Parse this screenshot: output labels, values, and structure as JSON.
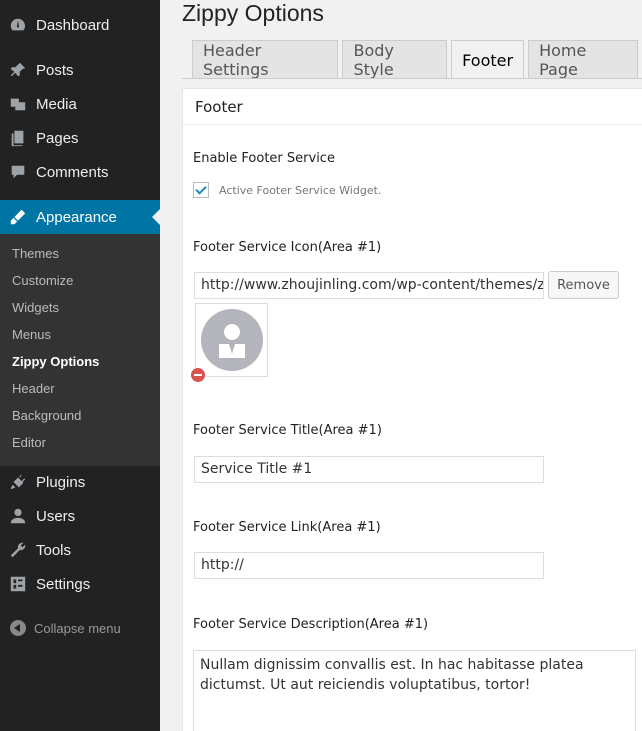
{
  "sidebar": {
    "items": [
      {
        "label": "Dashboard",
        "icon": "dashboard-icon"
      },
      {
        "label": "Posts",
        "icon": "pin-icon"
      },
      {
        "label": "Media",
        "icon": "media-icon"
      },
      {
        "label": "Pages",
        "icon": "pages-icon"
      },
      {
        "label": "Comments",
        "icon": "comment-icon"
      },
      {
        "label": "Appearance",
        "icon": "brush-icon"
      },
      {
        "label": "Plugins",
        "icon": "plug-icon"
      },
      {
        "label": "Users",
        "icon": "user-icon"
      },
      {
        "label": "Tools",
        "icon": "wrench-icon"
      },
      {
        "label": "Settings",
        "icon": "settings-icon"
      }
    ],
    "submenu": [
      "Themes",
      "Customize",
      "Widgets",
      "Menus",
      "Zippy Options",
      "Header",
      "Background",
      "Editor"
    ],
    "collapse_label": "Collapse menu"
  },
  "page": {
    "title": "Zippy Options",
    "tabs": [
      "Header Settings",
      "Body Style",
      "Footer",
      "Home Page"
    ],
    "active_tab": "Footer",
    "panel_title": "Footer"
  },
  "form": {
    "enable_label": "Enable Footer Service",
    "enable_checkbox_label": "Active Footer Service Widget.",
    "enable_checked": true,
    "icon_label": "Footer Service Icon(Area #1)",
    "icon_url": "http://www.zhoujinling.com/wp-content/themes/zi",
    "remove_button": "Remove",
    "title_label": "Footer Service Title(Area #1)",
    "title_value": "Service Title #1",
    "link_label": "Footer Service Link(Area #1)",
    "link_value": "http://",
    "desc_label": "Footer Service Description(Area #1)",
    "desc_value": "Nullam dignissim convallis est. In hac habitasse platea dictumst. Ut aut reiciendis voluptatibus, tortor!"
  },
  "colors": {
    "sidebar_bg": "#222222",
    "active_blue": "#0074a2",
    "checkbox_blue": "#1e8cbe"
  }
}
